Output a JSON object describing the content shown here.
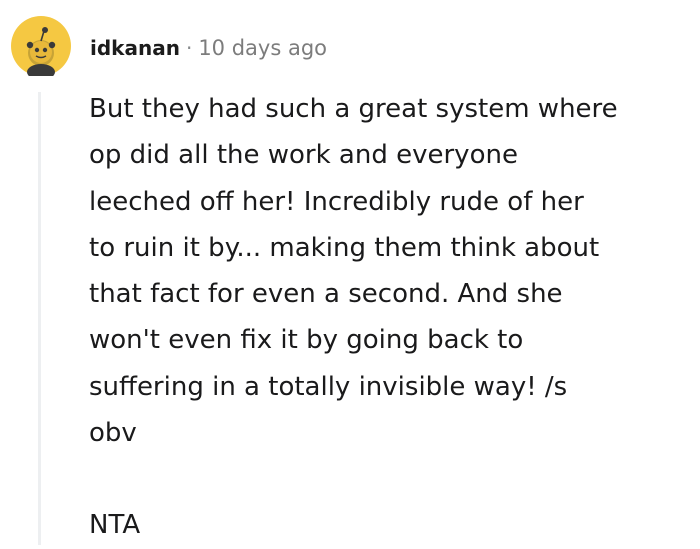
{
  "comment": {
    "username": "idkanan",
    "separator": "·",
    "timestamp": "10 days ago",
    "avatar_icon": "snoo-avatar-icon",
    "avatar_color": "#f5c842",
    "body_lines": [
      "But they had such a great system where",
      "op did all the work and everyone",
      "leeched off her! Incredibly rude of her",
      "to ruin it by... making them think about",
      "that fact for even a second. And she",
      "won't even fix it by going back to",
      "suffering in a totally invisible way! /s",
      "obv"
    ],
    "body_para2": "NTA"
  }
}
